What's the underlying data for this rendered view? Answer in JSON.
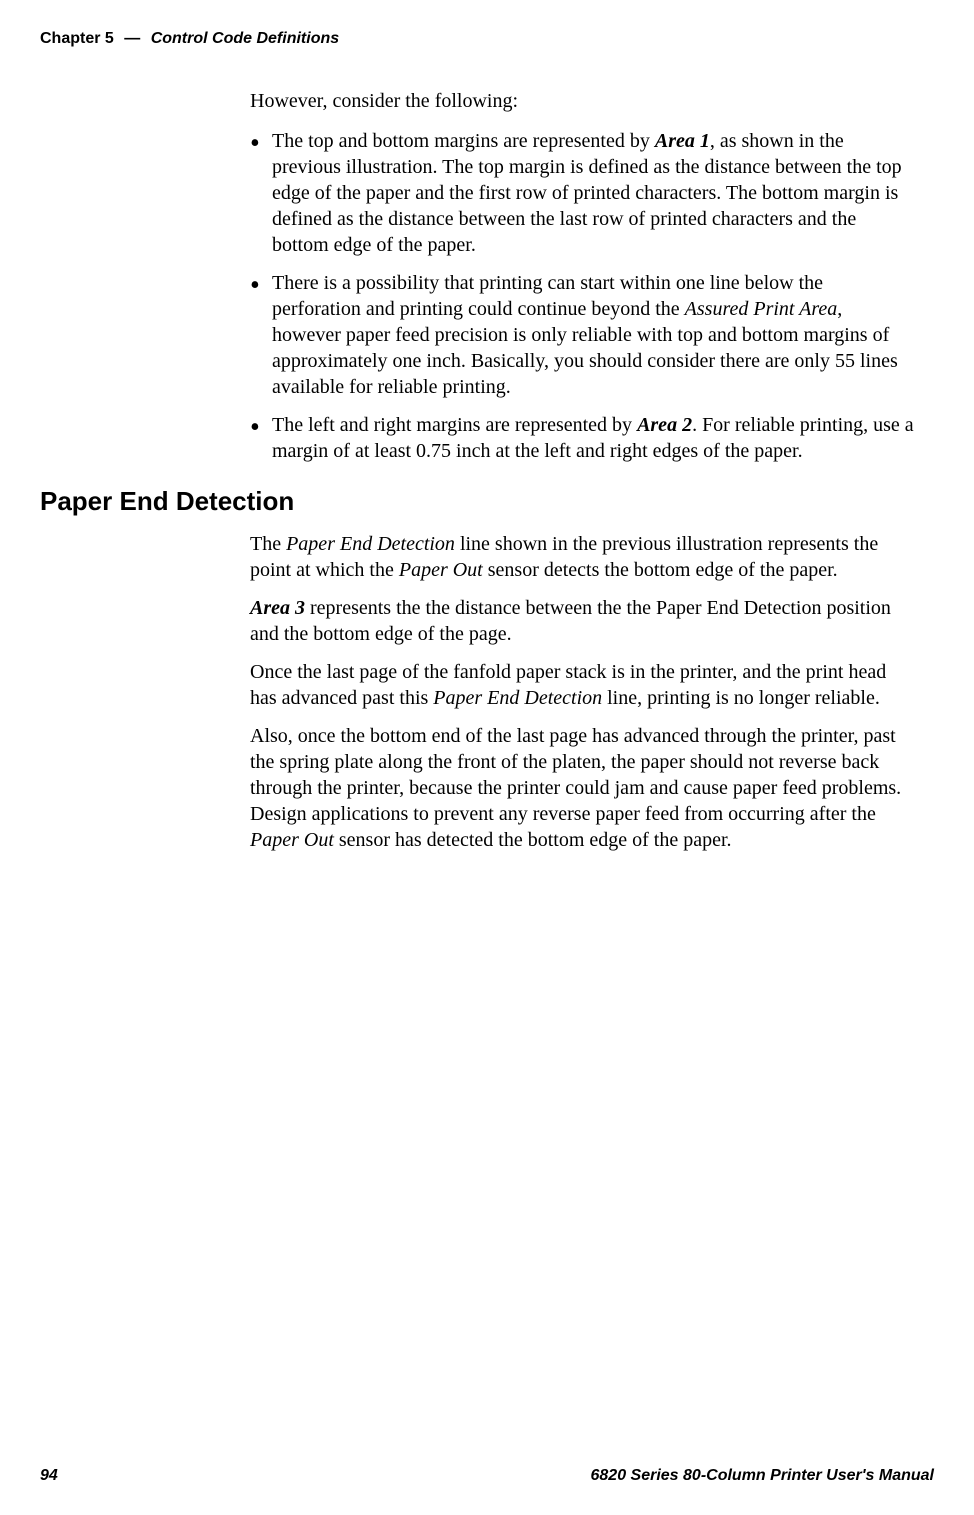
{
  "header": {
    "chapter": "Chapter 5",
    "dash": "—",
    "title": "Control Code Definitions"
  },
  "intro": "However, consider the following:",
  "bullets": [
    {
      "prefix": "The top and bottom margins are represented by ",
      "boldItalic1": "Area 1",
      "rest": ", as shown in the previous illustration. The top margin is defined as the distance between the top edge of the paper and the first row of printed characters. The bottom margin is defined as the distance between the last row of printed characters and the bottom edge of the paper."
    },
    {
      "prefix": "There is a possibility that printing can start within one line below the perforation and printing could continue beyond the ",
      "italic1": "Assured Print Area",
      "rest": ", however paper feed precision is only reliable with top and bottom margins of approximately one inch. Basically, you should consider there are only 55 lines available for reliable printing."
    },
    {
      "prefix": "The left and right margins are represented by ",
      "boldItalic1": "Area 2",
      "rest": ". For reliable printing, use a margin of at least 0.75 inch at the left and right edges of the paper."
    }
  ],
  "section": {
    "heading": "Paper End Detection",
    "para1": {
      "t1": "The ",
      "i1": "Paper End Detection",
      "t2": " line shown in the previous illustration represents the point at which the ",
      "i2": "Paper Out",
      "t3": " sensor detects the bottom edge of the paper."
    },
    "para2": {
      "b1": "Area 3",
      "t1": " represents the the distance between the the Paper End Detection position and the bottom edge of the page."
    },
    "para3": {
      "t1": "Once the last page of the fanfold paper stack is in the printer, and the print head has advanced past this ",
      "i1": "Paper End Detection",
      "t2": " line, printing is no longer reliable."
    },
    "para4": {
      "t1": "Also, once the bottom end of the last page has advanced through the printer, past the spring plate along the front of the platen, the paper should not reverse back through the printer, because the printer could jam and cause paper feed problems. Design applications to prevent any reverse paper feed from occurring after the ",
      "i1": "Paper Out",
      "t2": " sensor has detected the bottom edge of the paper."
    }
  },
  "footer": {
    "pageNum": "94",
    "manual": "6820 Series 80-Column Printer User's Manual"
  }
}
